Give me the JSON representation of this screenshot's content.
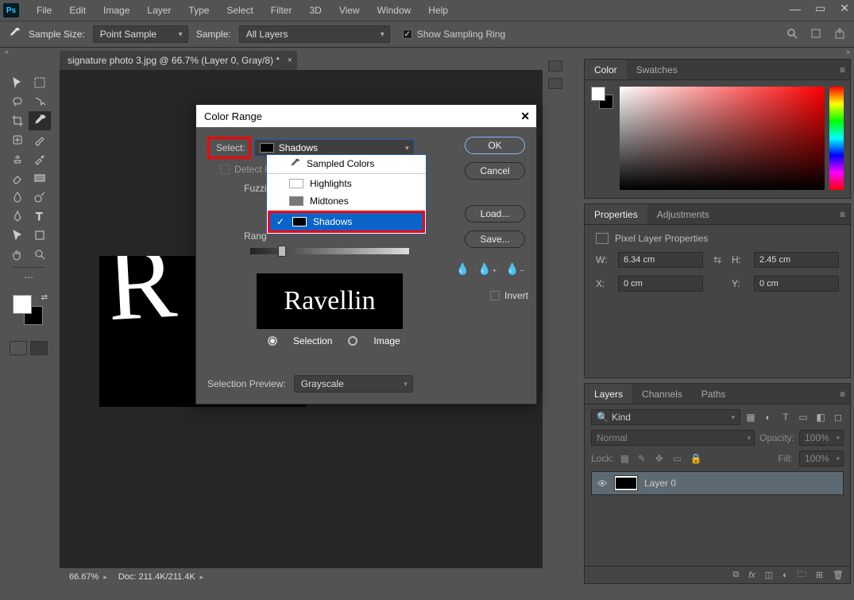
{
  "menubar": {
    "items": [
      "File",
      "Edit",
      "Image",
      "Layer",
      "Type",
      "Select",
      "Filter",
      "3D",
      "View",
      "Window",
      "Help"
    ],
    "logo": "Ps"
  },
  "optionsbar": {
    "sample_size_label": "Sample Size:",
    "sample_size_value": "Point Sample",
    "sample_label": "Sample:",
    "sample_value": "All Layers",
    "show_ring_label": "Show Sampling Ring",
    "show_ring_checked": true
  },
  "document": {
    "tab_title": "signature photo 3.jpg @ 66.7% (Layer 0, Gray/8) *"
  },
  "statusbar": {
    "zoom": "66.67%",
    "doc": "Doc: 211.4K/211.4K"
  },
  "dialog": {
    "title": "Color Range",
    "select_label": "Select:",
    "select_value": "Shadows",
    "dropdown_items": [
      "Sampled Colors",
      "Highlights",
      "Midtones",
      "Shadows"
    ],
    "detect_faces": "Detect Faces",
    "fuzziness_label": "Fuzziness:",
    "range_label": "Range:",
    "preview_text": "Ravellin",
    "selection_label": "Selection",
    "image_label": "Image",
    "selection_preview_label": "Selection Preview:",
    "selection_preview_value": "Grayscale",
    "buttons": {
      "ok": "OK",
      "cancel": "Cancel",
      "load": "Load...",
      "save": "Save..."
    },
    "invert_label": "Invert"
  },
  "panels": {
    "color": {
      "tab_color": "Color",
      "tab_swatches": "Swatches"
    },
    "properties": {
      "tab_props": "Properties",
      "tab_adj": "Adjustments",
      "title": "Pixel Layer Properties",
      "w_label": "W:",
      "w_value": "6.34 cm",
      "h_label": "H:",
      "h_value": "2.45 cm",
      "x_label": "X:",
      "x_value": "0 cm",
      "y_label": "Y:",
      "y_value": "0 cm"
    },
    "layers": {
      "tab_layers": "Layers",
      "tab_channels": "Channels",
      "tab_paths": "Paths",
      "kind": "Kind",
      "blend": "Normal",
      "opacity_label": "Opacity:",
      "opacity_value": "100%",
      "lock_label": "Lock:",
      "fill_label": "Fill:",
      "fill_value": "100%",
      "layer0": "Layer 0"
    }
  }
}
